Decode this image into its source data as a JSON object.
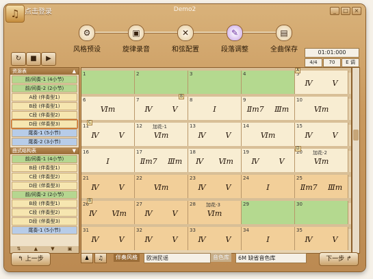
{
  "window": {
    "title": "Demo2",
    "login": "点击登录",
    "controls": [
      "_",
      "□",
      "×"
    ]
  },
  "steps": [
    {
      "label": "风格预设",
      "icon": "gear-icon",
      "glyph": "⚙"
    },
    {
      "label": "旋律录音",
      "icon": "record-icon",
      "glyph": "▣"
    },
    {
      "label": "和弦配置",
      "icon": "tools-icon",
      "glyph": "✕"
    },
    {
      "label": "段落调整",
      "icon": "wand-icon",
      "glyph": "✎"
    },
    {
      "label": "全曲保存",
      "icon": "save-icon",
      "glyph": "▤"
    }
  ],
  "transport": {
    "loop": "↻",
    "stop": "■",
    "play": "▶"
  },
  "time": {
    "position": "01:01:000",
    "meter": "4/4",
    "tempo": "70",
    "key": "E 调"
  },
  "left_panel": {
    "section1_title": "资源表",
    "section1": [
      {
        "label": "前/间奏-1 (4小节)",
        "color": "g"
      },
      {
        "label": "前/间奏-2 (2小节)",
        "color": "g"
      },
      {
        "label": "A段 (伴奏型1)",
        "color": "y"
      },
      {
        "label": "B段 (伴奏型1)",
        "color": "y"
      },
      {
        "label": "C段 (伴奏型2)",
        "color": "y"
      },
      {
        "label": "D段 (伴奏型3)",
        "color": "y",
        "selected": true
      },
      {
        "label": "尾奏-1 (5小节)",
        "color": "b"
      },
      {
        "label": "尾奏-2 (3小节)",
        "color": "b"
      }
    ],
    "section2_title": "曲式结构表",
    "section2": [
      {
        "label": "前/间奏-1 (4小节)",
        "color": "g"
      },
      {
        "label": "B段 (伴奏型1)",
        "color": "y"
      },
      {
        "label": "C段 (伴奏型2)",
        "color": "y"
      },
      {
        "label": "D段 (伴奏型3)",
        "color": "y"
      },
      {
        "label": "前/间奏-2 (2小节)",
        "color": "g"
      },
      {
        "label": "B段 (伴奏型1)",
        "color": "y"
      },
      {
        "label": "C段 (伴奏型2)",
        "color": "y"
      },
      {
        "label": "D段 (伴奏型3)",
        "color": "y"
      },
      {
        "label": "尾奏-1 (5小节)",
        "color": "b"
      }
    ]
  },
  "grid": {
    "rows": [
      {
        "cells": [
          {
            "n": "1",
            "c": "g"
          },
          {
            "n": "2",
            "c": "g"
          },
          {
            "n": "3",
            "c": "g"
          },
          {
            "n": "4",
            "c": "g"
          },
          {
            "n": "5",
            "c": "w",
            "ch": [
              "Ⅳ",
              "Ⅴ"
            ]
          }
        ]
      },
      {
        "cells": [
          {
            "n": "6",
            "c": "w",
            "ch": [
              "Ⅵm"
            ]
          },
          {
            "n": "7",
            "c": "w",
            "ch": [
              "Ⅳ",
              "Ⅴ"
            ]
          },
          {
            "n": "8",
            "c": "w",
            "ch": [
              "Ⅰ"
            ]
          },
          {
            "n": "9",
            "c": "w",
            "ch": [
              "Ⅱm7",
              "Ⅲm"
            ]
          },
          {
            "n": "10",
            "c": "w",
            "ch": [
              "Ⅵm"
            ]
          }
        ]
      },
      {
        "cells": [
          {
            "n": "11",
            "c": "w",
            "ch": [
              "Ⅳ",
              "Ⅴ"
            ]
          },
          {
            "n": "12",
            "c": "w",
            "a": "加花-1",
            "ch": [
              "Ⅵm"
            ]
          },
          {
            "n": "13",
            "c": "w",
            "ch": [
              "Ⅳ",
              "Ⅴ"
            ]
          },
          {
            "n": "14",
            "c": "w",
            "ch": [
              "Ⅵm"
            ]
          },
          {
            "n": "15",
            "c": "w",
            "ch": [
              "Ⅳ",
              "Ⅴ"
            ]
          }
        ]
      },
      {
        "cells": [
          {
            "n": "16",
            "c": "w",
            "ch": [
              "Ⅰ"
            ]
          },
          {
            "n": "17",
            "c": "w",
            "ch": [
              "Ⅱm7",
              "Ⅲm"
            ]
          },
          {
            "n": "18",
            "c": "w",
            "ch": [
              "Ⅳ",
              "Ⅵm"
            ]
          },
          {
            "n": "19",
            "c": "w",
            "ch": [
              "Ⅳ",
              "Ⅴ"
            ]
          },
          {
            "n": "20",
            "c": "w",
            "a": "加花-2",
            "ch": [
              "Ⅵm"
            ]
          }
        ]
      },
      {
        "cells": [
          {
            "n": "21",
            "c": "o",
            "ch": [
              "Ⅳ",
              "Ⅴ"
            ]
          },
          {
            "n": "22",
            "c": "o",
            "ch": [
              "Ⅵm"
            ]
          },
          {
            "n": "23",
            "c": "o",
            "ch": [
              "Ⅳ",
              "Ⅴ"
            ]
          },
          {
            "n": "24",
            "c": "o",
            "ch": [
              "Ⅰ"
            ]
          },
          {
            "n": "25",
            "c": "o",
            "ch": [
              "Ⅱm7",
              "Ⅲm"
            ]
          }
        ]
      },
      {
        "cells": [
          {
            "n": "26",
            "c": "o",
            "ch": [
              "Ⅳ",
              "Ⅵm"
            ]
          },
          {
            "n": "27",
            "c": "o",
            "ch": [
              "Ⅳ",
              "Ⅴ"
            ]
          },
          {
            "n": "28",
            "c": "o",
            "a": "加花-3",
            "ch": [
              "Ⅵm"
            ]
          },
          {
            "n": "29",
            "c": "g"
          },
          {
            "n": "30",
            "c": "g"
          }
        ]
      },
      {
        "cells": [
          {
            "n": "31",
            "c": "o",
            "ch": [
              "Ⅳ",
              "Ⅴ"
            ]
          },
          {
            "n": "32",
            "c": "o",
            "ch": [
              "Ⅳ",
              "Ⅴ"
            ]
          },
          {
            "n": "33",
            "c": "o",
            "ch": [
              "Ⅳ",
              "Ⅴ"
            ]
          },
          {
            "n": "34",
            "c": "o",
            "ch": [
              "Ⅰ"
            ]
          },
          {
            "n": "35",
            "c": "o",
            "ch": [
              "Ⅳ",
              "Ⅴ"
            ]
          }
        ]
      }
    ],
    "markers": [
      "A",
      "B",
      "C",
      "D",
      "B"
    ]
  },
  "bottom": {
    "style_label": "伴奏风格",
    "style_value": "欧洲民谣",
    "tone_label": "音色库",
    "tone_value": "6M 缺省音色库",
    "prev": "上一步",
    "next": "下一步"
  }
}
